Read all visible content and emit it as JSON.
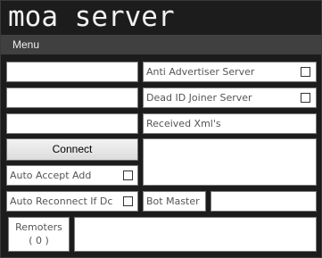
{
  "app": {
    "title": "moa server"
  },
  "menu": {
    "label": "Menu"
  },
  "inputs": {
    "field_1": "",
    "field_2": "",
    "field_3": "",
    "bot_master_value": "",
    "received_xml_value": "",
    "bottom_log_value": ""
  },
  "options": {
    "anti_advertiser": {
      "label": "Anti Advertiser Server",
      "checked": false
    },
    "dead_id_joiner": {
      "label": "Dead ID Joiner Server",
      "checked": false
    },
    "auto_accept_add": {
      "label": "Auto Accept Add",
      "checked": false
    },
    "auto_reconnect": {
      "label": "Auto Reconnect If Dc",
      "checked": false
    }
  },
  "labels": {
    "received_xml": "Received Xml's",
    "bot_master": "Bot Master"
  },
  "buttons": {
    "connect": "Connect"
  },
  "remoters": {
    "label": "Remoters",
    "count": "( 0 )"
  },
  "colors": {
    "window_bg": "#1c1c1c",
    "menubar_bg": "#404040",
    "text_light": "#f2f2f2",
    "label_text": "#555555"
  }
}
